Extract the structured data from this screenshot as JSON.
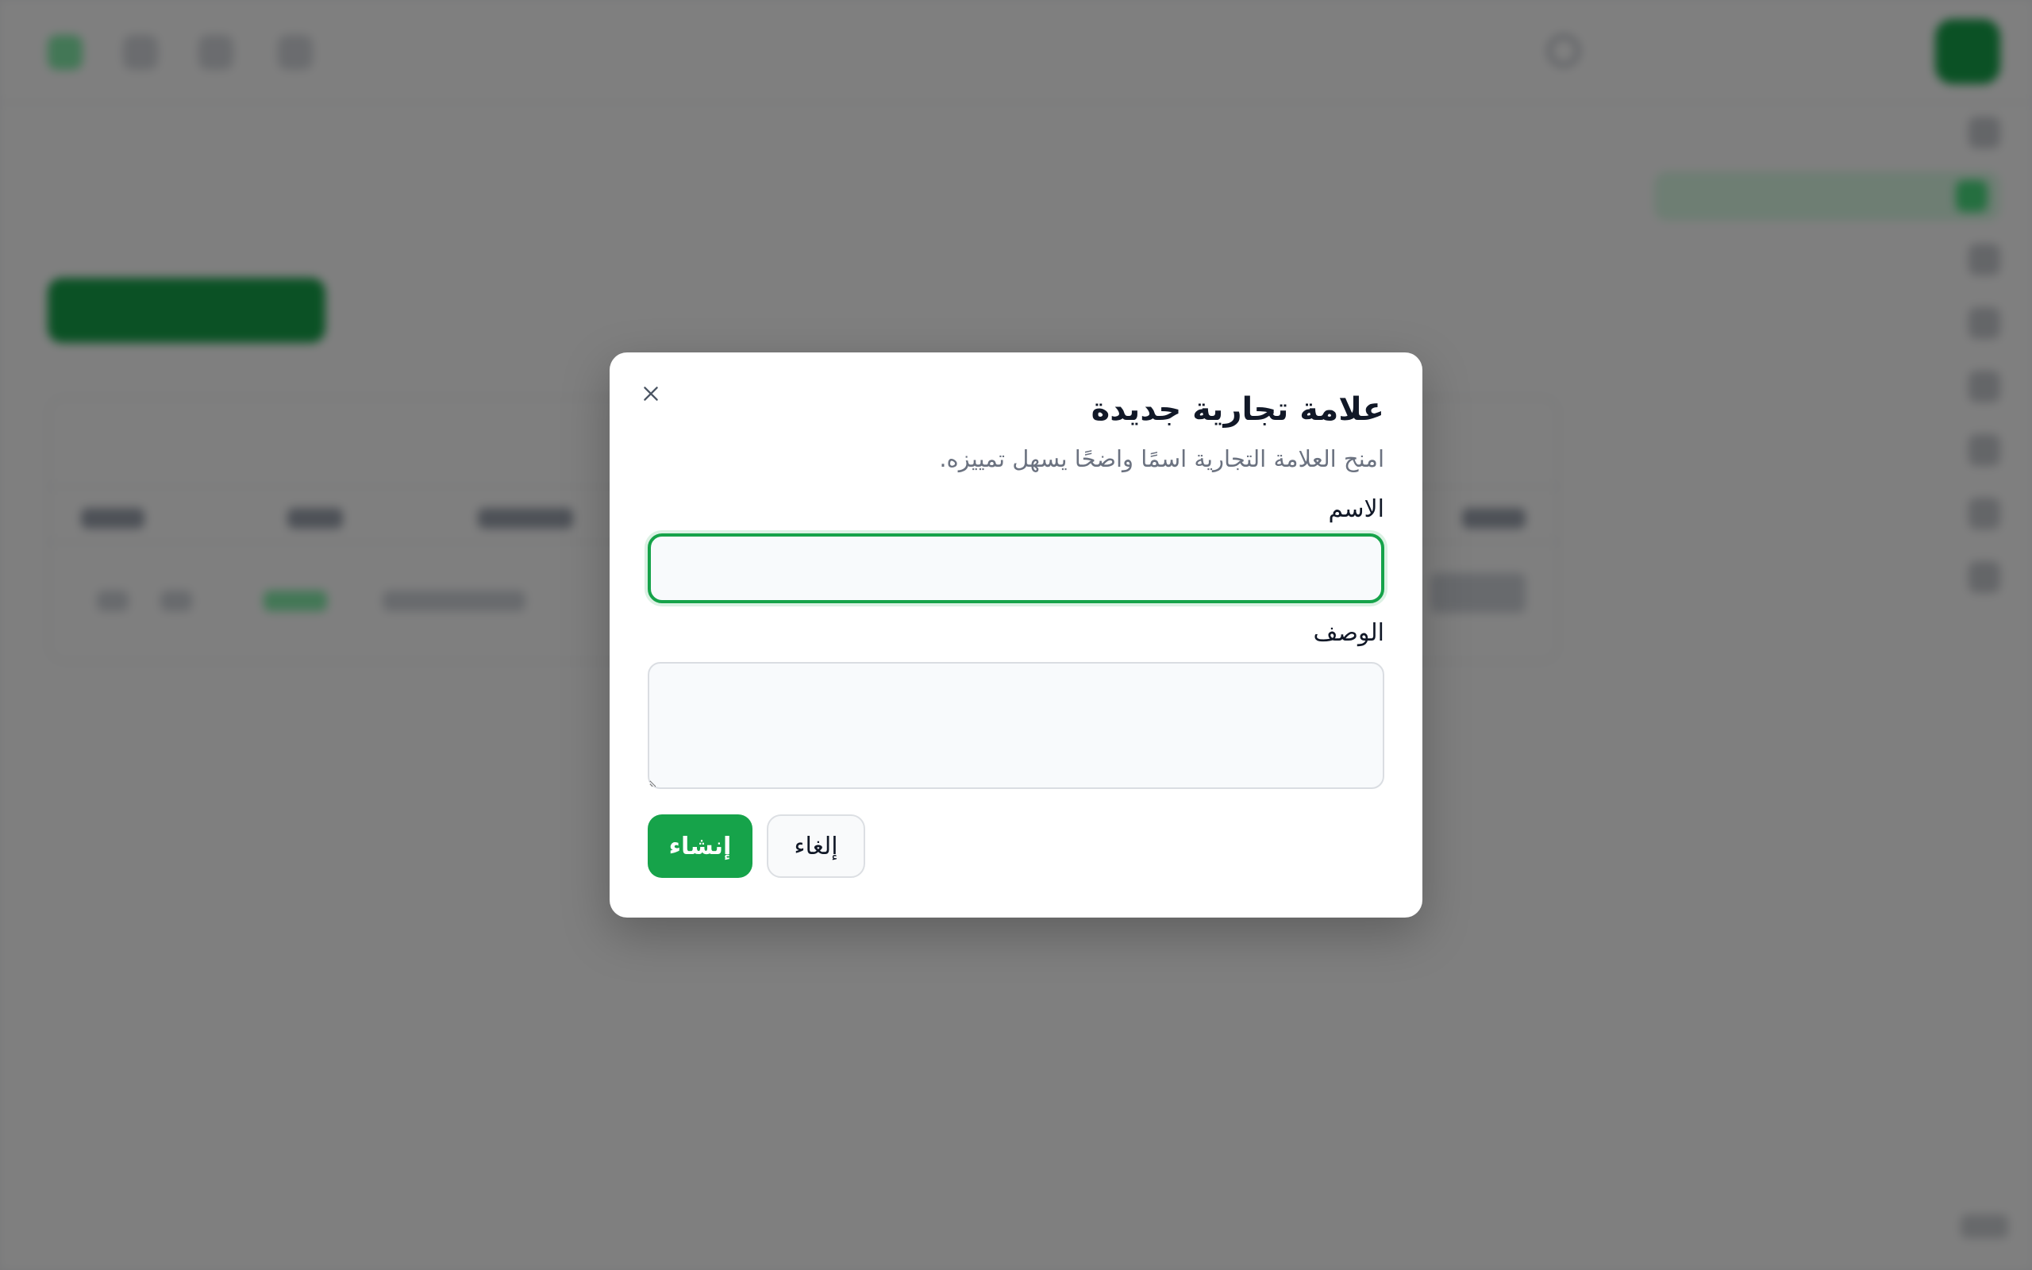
{
  "dialog": {
    "title": "علامة تجارية جديدة",
    "description": "امنح العلامة التجارية اسمًا واضحًا يسهل تمييزه.",
    "name_label": "الاسم",
    "name_value": "",
    "description_label": "الوصف",
    "description_value": "",
    "create_label": "إنشاء",
    "cancel_label": "إلغاء",
    "close_icon": "close-icon"
  },
  "colors": {
    "accent": "#16a34a",
    "overlay": "rgba(0,0,0,0.5)",
    "text_primary": "#111827",
    "text_muted": "#6b7280"
  }
}
